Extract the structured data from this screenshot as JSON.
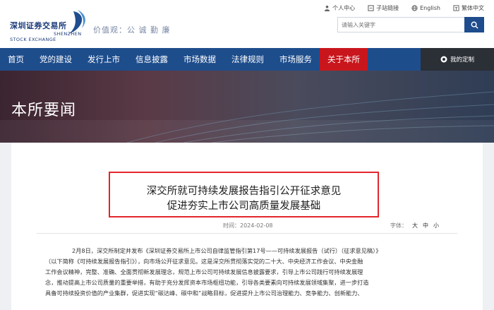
{
  "header": {
    "logo_cn": "深圳证券交易所",
    "logo_en_line1": "SHENZHEN",
    "logo_en_line2": "STOCK EXCHANGE",
    "slogan": "价值观：公 诚 勤 廉",
    "toplinks": [
      {
        "label": "个人中心",
        "icon": "person-icon"
      },
      {
        "label": "子站链接",
        "icon": "link-icon"
      },
      {
        "label": "English",
        "icon": "globe-icon"
      },
      {
        "label": "繁体中文",
        "icon": "text-icon"
      }
    ],
    "search_placeholder": "请输入关键字"
  },
  "nav": {
    "items": [
      "首页",
      "党的建设",
      "发行上市",
      "信息披露",
      "市场数据",
      "法律规则",
      "市场服务",
      "关于本所"
    ],
    "active_index": 7,
    "custom_label": "我的定制"
  },
  "banner": {
    "title": "本所要闻"
  },
  "article": {
    "title_line1": "深交所就可持续发展报告指引公开征求意见",
    "title_line2": "促进夯实上市公司高质量发展基础",
    "time_label": "时间：",
    "time_value": "2024-02-08",
    "font_label": "字体：",
    "font_sizes": [
      "大",
      "中",
      "小"
    ],
    "paragraphs": [
      "2月8日，深交所制定并发布《深圳证券交易所上市公司自律监管指引第17号——可持续发展报告（试行）（征求意见稿）》",
      "（以下简称《可持续发展报告指引》），向市场公开征求意见。这是深交所贯彻落实党的二十大、中央经济工作会议、中央金融",
      "工作会议精神，完整、准确、全面贯彻新发展理念，规范上市公司可持续发展信息披露要求，引导上市公司践行可持续发展理",
      "念，推动提高上市公司质量的重要举措，有助于充分发挥资本市场枢纽功能，引导各类要素向可持续发展领域集聚，进一步打造",
      "具备可持续投资价值的产业集群，促进实现“碳达峰、碳中和”战略目标，促进提升上市公司治理能力、竞争能力、创新能力、"
    ]
  },
  "colors": {
    "nav_bg": "#1e4d8c",
    "nav_active": "#c9161d",
    "highlight_border": "#e3262b"
  }
}
